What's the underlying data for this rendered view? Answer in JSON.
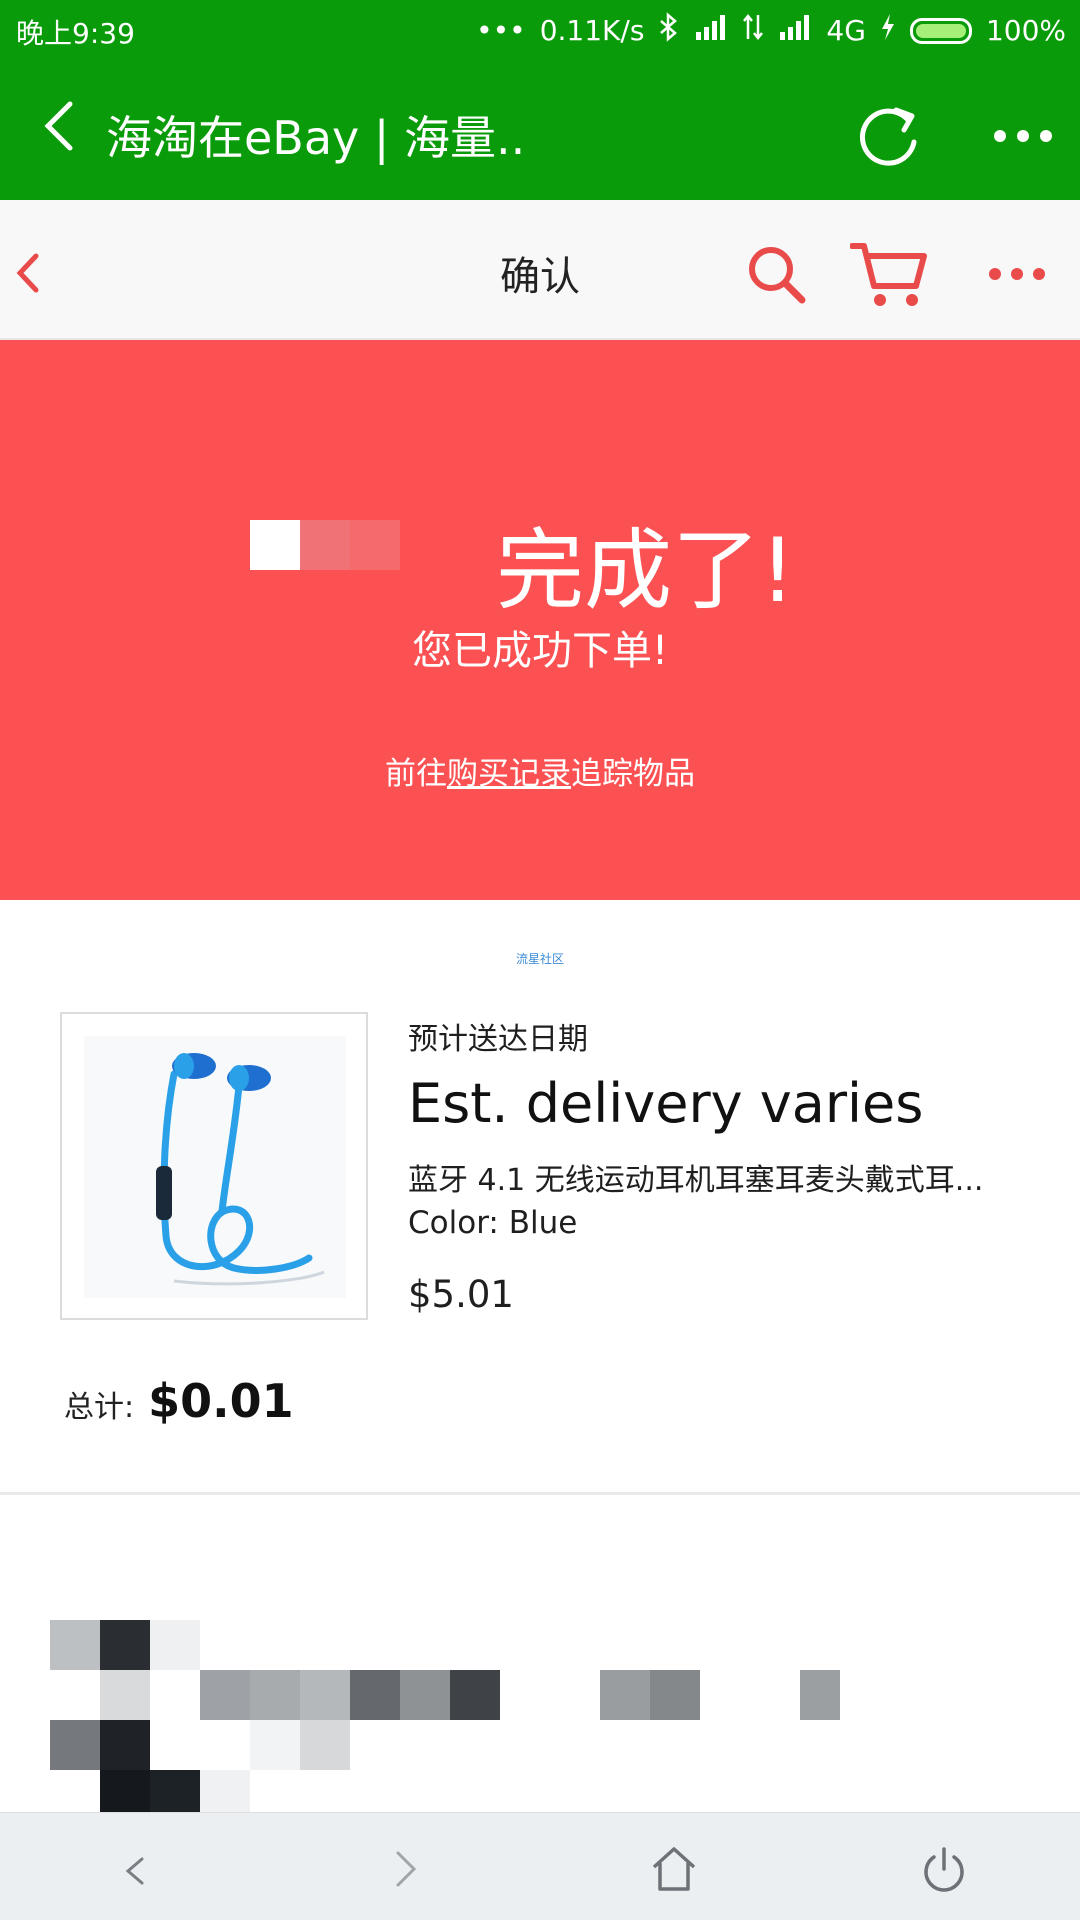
{
  "status_bar": {
    "time": "晚上9:39",
    "dots": "•••",
    "speed": "0.11K/s",
    "network": "4G",
    "battery": "100%"
  },
  "wechat_bar": {
    "title": "海淘在eBay | 海量.."
  },
  "ebay_header": {
    "title": "确认"
  },
  "banner": {
    "headline": "完成了!",
    "subtitle": "您已成功下单!",
    "link_prefix": "前往",
    "link_text": "购买记录",
    "link_suffix": "追踪物品"
  },
  "watermark": "流星社区",
  "item": {
    "delivery_label": "预计送达日期",
    "delivery_value": "Est. delivery varies",
    "name": "蓝牙 4.1 无线运动耳机耳塞耳麦头戴式耳...",
    "color": "Color: Blue",
    "price": "$5.01"
  },
  "total": {
    "label": "总计:",
    "amount": "$0.01"
  },
  "colors": {
    "wechat_green": "#0a9b0a",
    "ebay_red": "#fb5152",
    "earphone_blue": "#2aa0e8"
  }
}
